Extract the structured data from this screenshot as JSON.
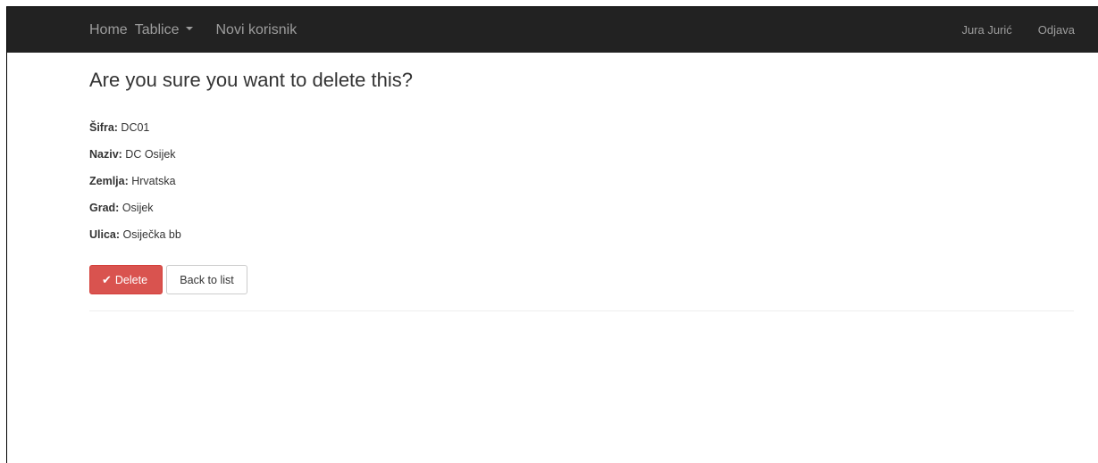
{
  "navbar": {
    "home": "Home",
    "tablice": "Tablice",
    "novi_korisnik": "Novi korisnik",
    "user": "Jura Jurić",
    "logout": "Odjava"
  },
  "page": {
    "title": "Are you sure you want to delete this?"
  },
  "fields": [
    {
      "label": "Šifra:",
      "value": " DC01"
    },
    {
      "label": "Naziv:",
      "value": " DC Osijek"
    },
    {
      "label": "Zemlja:",
      "value": " Hrvatska"
    },
    {
      "label": "Grad:",
      "value": " Osijek"
    },
    {
      "label": "Ulica:",
      "value": " Osiječka bb"
    }
  ],
  "actions": {
    "delete_label": "Delete",
    "back_label": "Back to list"
  },
  "colors": {
    "navbar_bg": "#222222",
    "delete_bg": "#d9534f"
  },
  "icons": {
    "delete_icon": "check-icon",
    "dropdown_icon": "caret-down-icon"
  }
}
